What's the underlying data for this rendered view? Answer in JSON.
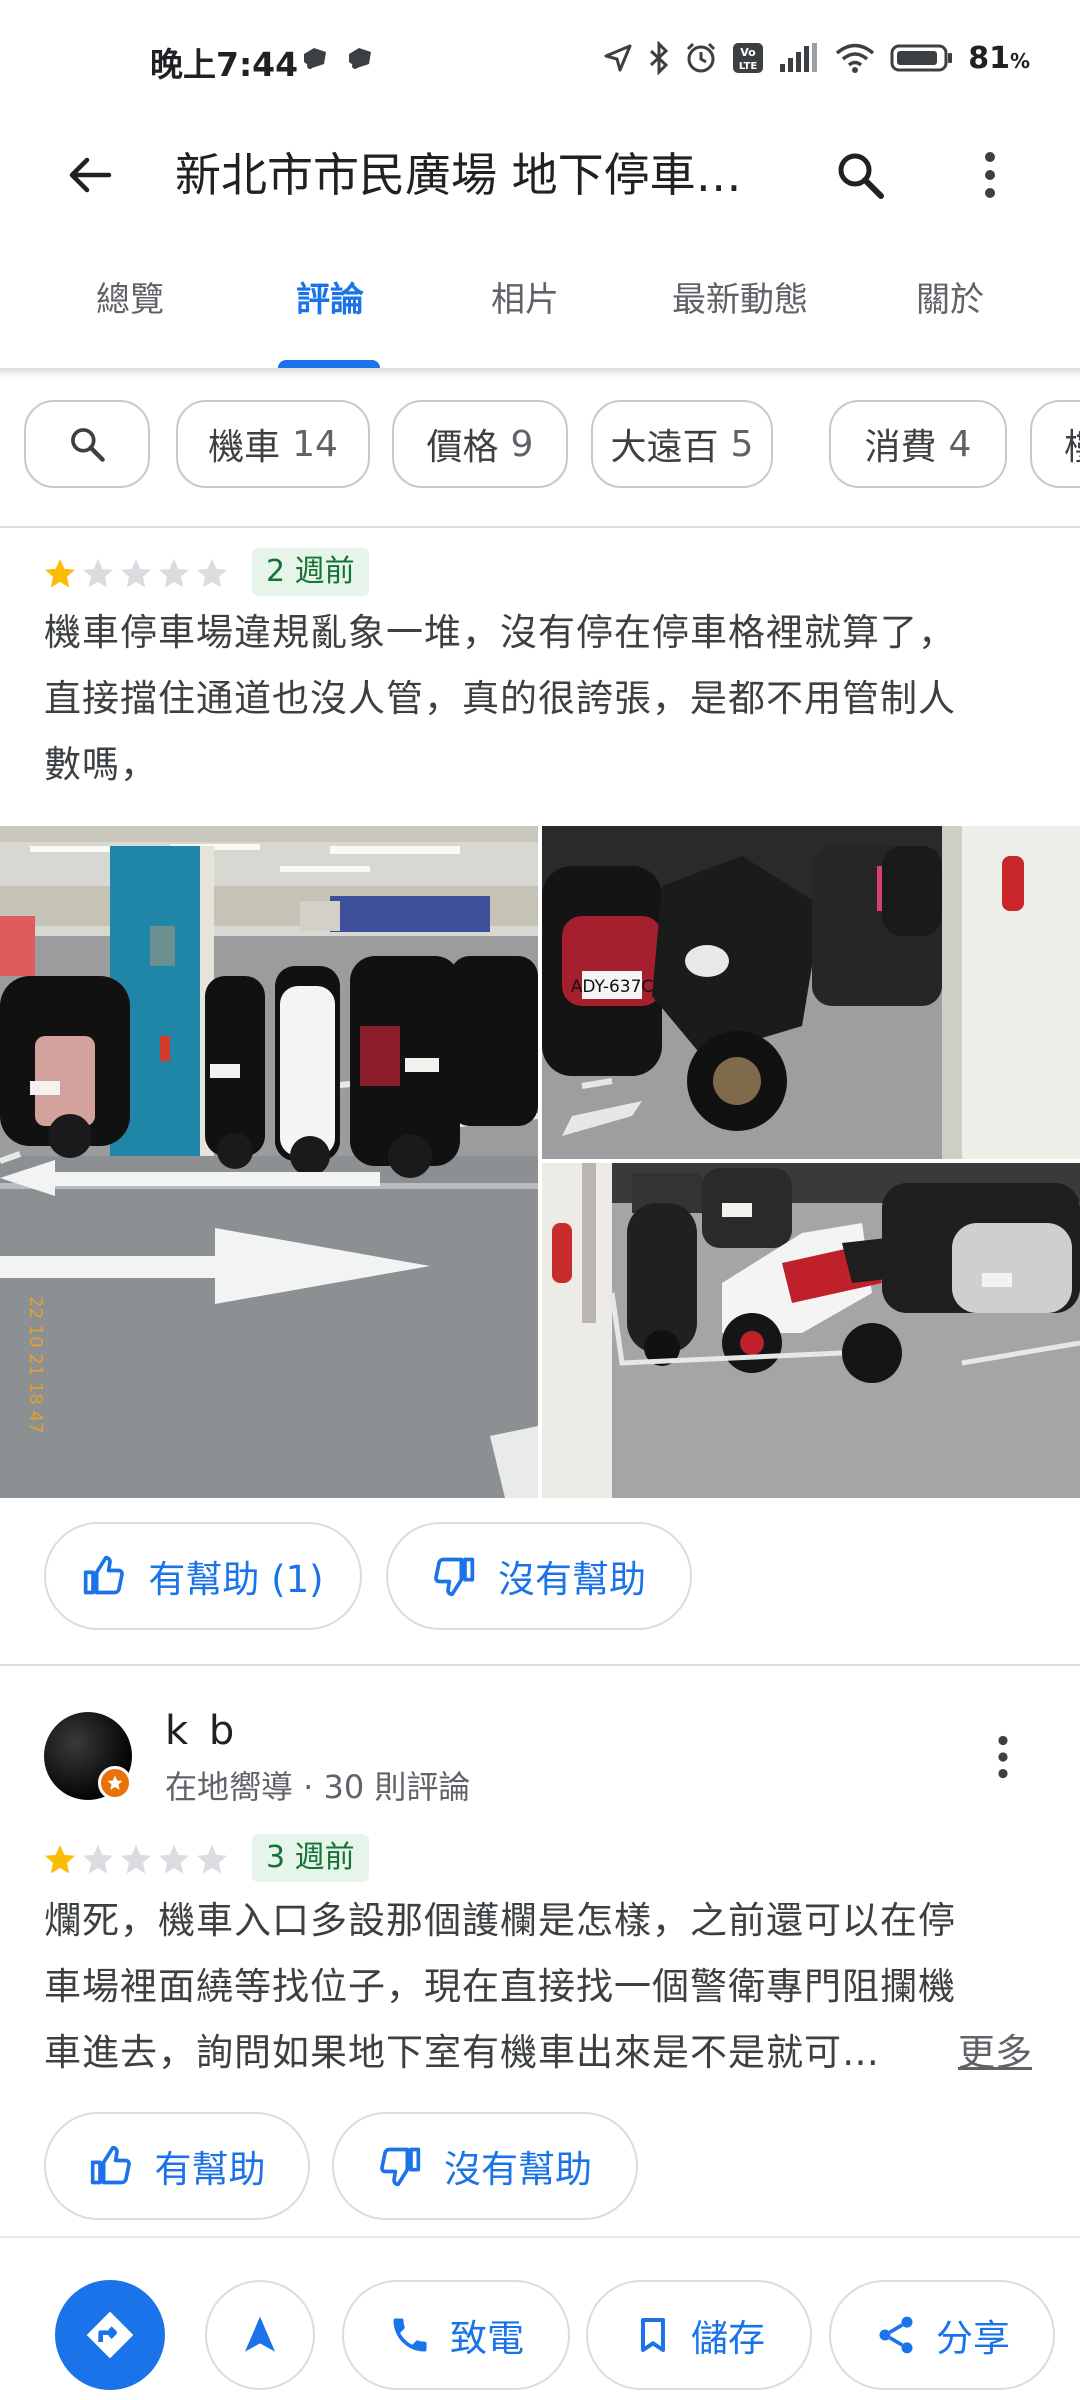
{
  "status_bar": {
    "time": "晚上7:44",
    "battery": "81",
    "battery_unit": "%"
  },
  "app_bar": {
    "title": "新北市市民廣場 地下停車…",
    "back_icon": "arrow-back-icon",
    "search_icon": "search-icon",
    "more_icon": "more-vert-icon"
  },
  "tabs": [
    {
      "label": "總覽",
      "active": false
    },
    {
      "label": "評論",
      "active": true
    },
    {
      "label": "相片",
      "active": false
    },
    {
      "label": "最新動態",
      "active": false
    },
    {
      "label": "關於",
      "active": false
    }
  ],
  "filter_chips": [
    {
      "label": "機車",
      "count": "14"
    },
    {
      "label": "價格",
      "count": "9"
    },
    {
      "label": "大遠百",
      "count": "5"
    },
    {
      "label": "消費",
      "count": "4"
    },
    {
      "label": "樓",
      "count": ""
    }
  ],
  "reviews": [
    {
      "rating": 1,
      "time_ago": "2 週前",
      "text_lines": [
        "機車停車場違規亂象一堆，沒有停在停車格裡就算了，",
        "直接擋住通道也沒人管，真的很誇張，是都不用管制人",
        "數嗎，"
      ],
      "photos": [
        "parking-garage-scooters-photo",
        "scooters-closeup-photo",
        "scooters-row-photo"
      ],
      "helpful_label": "有幫助 (1)",
      "not_helpful_label": "沒有幫助"
    },
    {
      "reviewer_name": "k b",
      "reviewer_meta": "在地嚮導 · 30 則評論",
      "rating": 1,
      "time_ago": "3 週前",
      "text_lines": [
        "爛死，機車入口多設那個護欄是怎樣，之前還可以在停",
        "車場裡面繞等找位子，現在直接找一個警衛專門阻攔機",
        "車進去，詢問如果地下室有機車出來是不是就可…"
      ],
      "more_label": "更多",
      "helpful_label": "有幫助",
      "not_helpful_label": "沒有幫助"
    }
  ],
  "bottom_bar": {
    "call_label": "致電",
    "save_label": "儲存",
    "share_label": "分享"
  },
  "colors": {
    "accent": "#1a73e8",
    "star": "#fbbc04",
    "badge_bg": "#e6f4ea",
    "badge_text": "#137333"
  }
}
